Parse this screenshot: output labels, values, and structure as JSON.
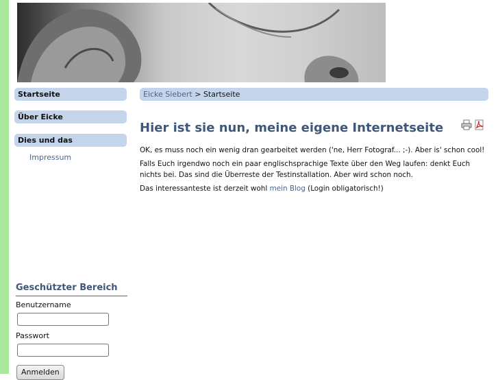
{
  "nav": {
    "items": [
      {
        "label": "Startseite"
      },
      {
        "label": "Über Eicke"
      },
      {
        "label": "Dies und das"
      }
    ],
    "sub_items": [
      {
        "label": "Impressum"
      }
    ]
  },
  "breadcrumb": {
    "link": "Eicke Siebert",
    "separator": ">",
    "current": "Startseite"
  },
  "article": {
    "title": "Hier ist sie nun, meine eigene Internetseite",
    "paragraphs": [
      "OK, es muss noch ein wenig dran gearbeitet werden ('ne, Herr Fotograf... ;-). Aber is' schon cool!",
      "Falls Euch irgendwo noch ein paar englischsprachige Texte über den Weg laufen: denkt Euch nichts bei. Das sind die Überreste der Testinstallation. Aber wird schon noch."
    ],
    "last_paragraph": {
      "before": "Das interessanteste ist derzeit wohl ",
      "link": "mein Blog",
      "after": " (Login obligatorisch!)"
    },
    "icons": [
      "print-icon",
      "pdf-icon"
    ]
  },
  "login": {
    "title": "Geschützter Bereich",
    "username_label": "Benutzername",
    "password_label": "Passwort",
    "submit_label": "Anmelden"
  },
  "colors": {
    "nav_bg": "#c4d4ea",
    "heading": "#3f5778",
    "link": "#4a6488",
    "left_stripe": "#a9e89a"
  }
}
